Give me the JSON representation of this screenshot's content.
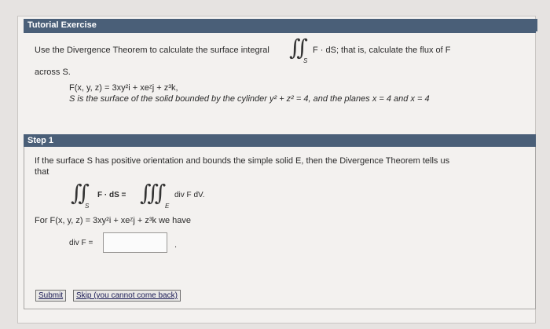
{
  "tutorial": {
    "header": "Tutorial Exercise",
    "intro_before": "Use the Divergence Theorem to calculate the surface integral",
    "intro_after": "F · dS; that is, calculate the flux of F",
    "across": "across S.",
    "field_def": "F(x, y, z) = 3xy²i + xeᶻj + z³k,",
    "surface_desc": "S is the surface of the solid bounded by the cylinder y² + z² = 4, and the planes x = 4 and x = 4"
  },
  "step1": {
    "header": "Step 1",
    "line1": "If the surface S has positive orientation and bounds the simple solid E, then the Divergence Theorem tells us",
    "line2": "that",
    "lhs": "F · dS =",
    "rhs": "div F dV.",
    "sub_s": "S",
    "sub_e": "E",
    "for_line": "For F(x, y, z) = 3xy²i + xeᶻj + z³k we have",
    "div_label": "div F =",
    "answer_value": "",
    "period": "."
  },
  "buttons": {
    "submit": "Submit",
    "skip": "Skip (you cannot come back)"
  }
}
